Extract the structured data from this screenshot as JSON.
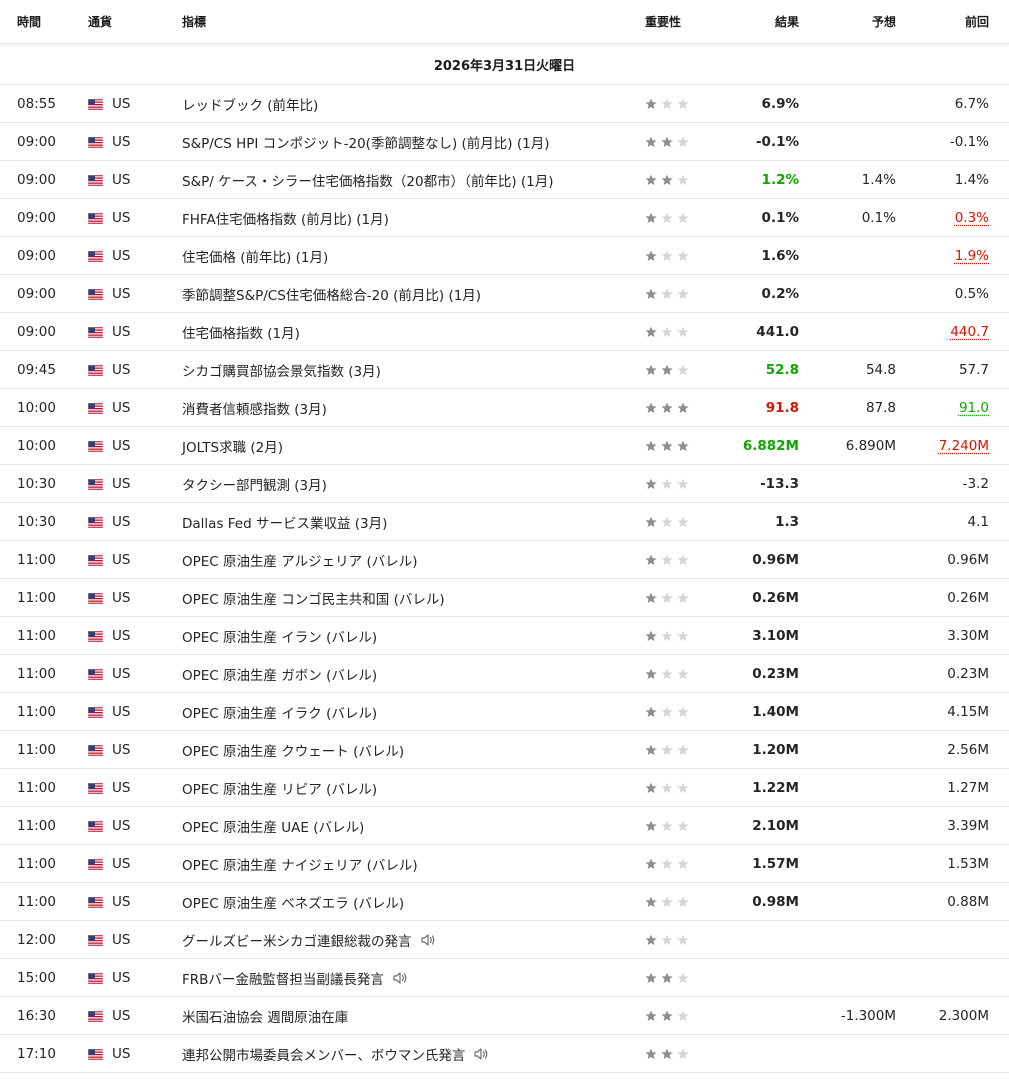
{
  "header": {
    "time": "時間",
    "currency": "通貨",
    "indicator": "指標",
    "importance": "重要性",
    "result": "結果",
    "forecast": "予想",
    "previous": "前回"
  },
  "date_label": "2026年3月31日火曜日",
  "colors": {
    "positive": "#0ea600",
    "negative": "#d91400",
    "star_active": "#8b8e92",
    "star_inactive": "#d4d6d9"
  },
  "rows": [
    {
      "time": "08:55",
      "currency": "US",
      "indicator": "レッドブック (前年比)",
      "importance": 1,
      "actual": "6.9%",
      "actual_status": "",
      "forecast": "",
      "previous": "6.7%",
      "previous_status": "",
      "speech": false
    },
    {
      "time": "09:00",
      "currency": "US",
      "indicator": "S&P/CS HPI コンポジット-20(季節調整なし) (前月比) (1月)",
      "importance": 2,
      "actual": "-0.1%",
      "actual_status": "",
      "forecast": "",
      "previous": "-0.1%",
      "previous_status": "",
      "speech": false
    },
    {
      "time": "09:00",
      "currency": "US",
      "indicator": "S&P/ ケース・シラー住宅価格指数（20都市）（前年比) (1月)",
      "importance": 2,
      "actual": "1.2%",
      "actual_status": "positive",
      "forecast": "1.4%",
      "previous": "1.4%",
      "previous_status": "",
      "speech": false
    },
    {
      "time": "09:00",
      "currency": "US",
      "indicator": "FHFA住宅価格指数 (前月比) (1月)",
      "importance": 1,
      "actual": "0.1%",
      "actual_status": "",
      "forecast": "0.1%",
      "previous": "0.3%",
      "previous_status": "negative",
      "speech": false
    },
    {
      "time": "09:00",
      "currency": "US",
      "indicator": "住宅価格 (前年比) (1月)",
      "importance": 1,
      "actual": "1.6%",
      "actual_status": "",
      "forecast": "",
      "previous": "1.9%",
      "previous_status": "negative",
      "speech": false
    },
    {
      "time": "09:00",
      "currency": "US",
      "indicator": "季節調整S&P/CS住宅価格総合-20 (前月比) (1月)",
      "importance": 1,
      "actual": "0.2%",
      "actual_status": "",
      "forecast": "",
      "previous": "0.5%",
      "previous_status": "",
      "speech": false
    },
    {
      "time": "09:00",
      "currency": "US",
      "indicator": "住宅価格指数 (1月)",
      "importance": 1,
      "actual": "441.0",
      "actual_status": "",
      "forecast": "",
      "previous": "440.7",
      "previous_status": "negative",
      "speech": false
    },
    {
      "time": "09:45",
      "currency": "US",
      "indicator": "シカゴ購買部協会景気指数 (3月)",
      "importance": 2,
      "actual": "52.8",
      "actual_status": "positive",
      "forecast": "54.8",
      "previous": "57.7",
      "previous_status": "",
      "speech": false
    },
    {
      "time": "10:00",
      "currency": "US",
      "indicator": "消費者信頼感指数 (3月)",
      "importance": 3,
      "actual": "91.8",
      "actual_status": "negative",
      "forecast": "87.8",
      "previous": "91.0",
      "previous_status": "positive",
      "speech": false
    },
    {
      "time": "10:00",
      "currency": "US",
      "indicator": "JOLTS求職 (2月)",
      "importance": 3,
      "actual": "6.882M",
      "actual_status": "positive",
      "forecast": "6.890M",
      "previous": "7.240M",
      "previous_status": "negative",
      "speech": false
    },
    {
      "time": "10:30",
      "currency": "US",
      "indicator": "タクシー部門観測 (3月)",
      "importance": 1,
      "actual": "-13.3",
      "actual_status": "",
      "forecast": "",
      "previous": "-3.2",
      "previous_status": "",
      "speech": false
    },
    {
      "time": "10:30",
      "currency": "US",
      "indicator": "Dallas Fed サービス業収益 (3月)",
      "importance": 1,
      "actual": "1.3",
      "actual_status": "",
      "forecast": "",
      "previous": "4.1",
      "previous_status": "",
      "speech": false
    },
    {
      "time": "11:00",
      "currency": "US",
      "indicator": "OPEC 原油生産 アルジェリア (バレル)",
      "importance": 1,
      "actual": "0.96M",
      "actual_status": "",
      "forecast": "",
      "previous": "0.96M",
      "previous_status": "",
      "speech": false
    },
    {
      "time": "11:00",
      "currency": "US",
      "indicator": "OPEC 原油生産 コンゴ民主共和国 (バレル)",
      "importance": 1,
      "actual": "0.26M",
      "actual_status": "",
      "forecast": "",
      "previous": "0.26M",
      "previous_status": "",
      "speech": false
    },
    {
      "time": "11:00",
      "currency": "US",
      "indicator": "OPEC 原油生産 イラン (バレル)",
      "importance": 1,
      "actual": "3.10M",
      "actual_status": "",
      "forecast": "",
      "previous": "3.30M",
      "previous_status": "",
      "speech": false
    },
    {
      "time": "11:00",
      "currency": "US",
      "indicator": "OPEC 原油生産 ガボン (バレル)",
      "importance": 1,
      "actual": "0.23M",
      "actual_status": "",
      "forecast": "",
      "previous": "0.23M",
      "previous_status": "",
      "speech": false
    },
    {
      "time": "11:00",
      "currency": "US",
      "indicator": "OPEC 原油生産 イラク (バレル)",
      "importance": 1,
      "actual": "1.40M",
      "actual_status": "",
      "forecast": "",
      "previous": "4.15M",
      "previous_status": "",
      "speech": false
    },
    {
      "time": "11:00",
      "currency": "US",
      "indicator": "OPEC 原油生産 クウェート (バレル)",
      "importance": 1,
      "actual": "1.20M",
      "actual_status": "",
      "forecast": "",
      "previous": "2.56M",
      "previous_status": "",
      "speech": false
    },
    {
      "time": "11:00",
      "currency": "US",
      "indicator": "OPEC 原油生産 リビア (バレル)",
      "importance": 1,
      "actual": "1.22M",
      "actual_status": "",
      "forecast": "",
      "previous": "1.27M",
      "previous_status": "",
      "speech": false
    },
    {
      "time": "11:00",
      "currency": "US",
      "indicator": "OPEC 原油生産 UAE (バレル)",
      "importance": 1,
      "actual": "2.10M",
      "actual_status": "",
      "forecast": "",
      "previous": "3.39M",
      "previous_status": "",
      "speech": false
    },
    {
      "time": "11:00",
      "currency": "US",
      "indicator": "OPEC 原油生産 ナイジェリア (バレル)",
      "importance": 1,
      "actual": "1.57M",
      "actual_status": "",
      "forecast": "",
      "previous": "1.53M",
      "previous_status": "",
      "speech": false
    },
    {
      "time": "11:00",
      "currency": "US",
      "indicator": "OPEC 原油生産 ベネズエラ (バレル)",
      "importance": 1,
      "actual": "0.98M",
      "actual_status": "",
      "forecast": "",
      "previous": "0.88M",
      "previous_status": "",
      "speech": false
    },
    {
      "time": "12:00",
      "currency": "US",
      "indicator": "グールズビー米シカゴ連銀総裁の発言",
      "importance": 1,
      "actual": "",
      "actual_status": "",
      "forecast": "",
      "previous": "",
      "previous_status": "",
      "speech": true
    },
    {
      "time": "15:00",
      "currency": "US",
      "indicator": "FRBバー金融監督担当副議長発言",
      "importance": 2,
      "actual": "",
      "actual_status": "",
      "forecast": "",
      "previous": "",
      "previous_status": "",
      "speech": true
    },
    {
      "time": "16:30",
      "currency": "US",
      "indicator": "米国石油協会 週間原油在庫",
      "importance": 2,
      "actual": "",
      "actual_status": "",
      "forecast": "-1.300M",
      "previous": "2.300M",
      "previous_status": "",
      "speech": false
    },
    {
      "time": "17:10",
      "currency": "US",
      "indicator": "連邦公開市場委員会メンバー、ボウマン氏発言",
      "importance": 2,
      "actual": "",
      "actual_status": "",
      "forecast": "",
      "previous": "",
      "previous_status": "",
      "speech": true
    }
  ]
}
